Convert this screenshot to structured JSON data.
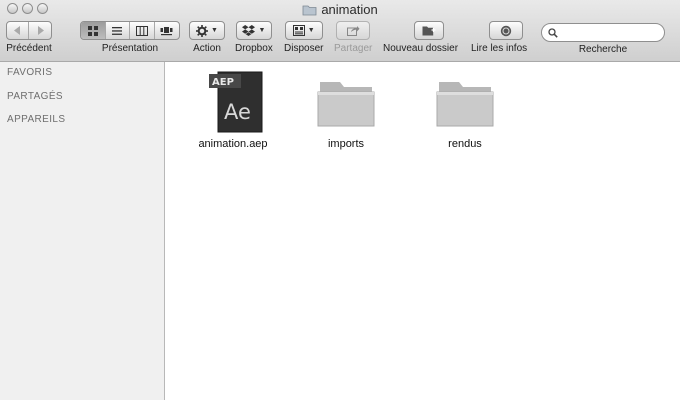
{
  "window": {
    "title": "animation"
  },
  "toolbar": {
    "back_label": "Précédent",
    "view_label": "Présentation",
    "action_label": "Action",
    "dropbox_label": "Dropbox",
    "arrange_label": "Disposer",
    "share_label": "Partager",
    "new_folder_label": "Nouveau dossier",
    "get_info_label": "Lire les infos",
    "search_label": "Recherche",
    "search_placeholder": ""
  },
  "sidebar": {
    "sections": [
      "FAVORIS",
      "PARTAGÉS",
      "APPAREILS"
    ]
  },
  "files": [
    {
      "name": "animation.aep",
      "icon": "after-effects-file-icon",
      "badge": "AEP",
      "glyph": "Ae"
    },
    {
      "name": "imports",
      "icon": "folder-icon"
    },
    {
      "name": "rendus",
      "icon": "folder-icon"
    }
  ]
}
